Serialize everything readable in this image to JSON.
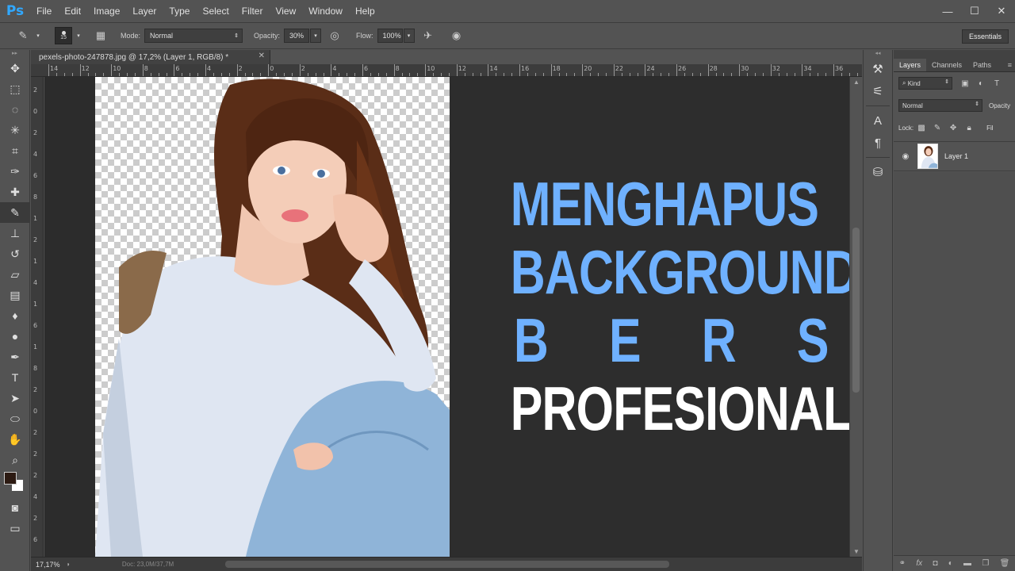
{
  "app": {
    "logo": "Ps"
  },
  "menu": [
    "File",
    "Edit",
    "Image",
    "Layer",
    "Type",
    "Select",
    "Filter",
    "View",
    "Window",
    "Help"
  ],
  "window_controls": [
    "—",
    "☐",
    "✕"
  ],
  "options": {
    "brush_size": "15",
    "mode_label": "Mode:",
    "mode_value": "Normal",
    "opacity_label": "Opacity:",
    "opacity_value": "30%",
    "flow_label": "Flow:",
    "flow_value": "100%",
    "workspace": "Essentials"
  },
  "document": {
    "tab_title": "pexels-photo-247878.jpg @ 17,2% (Layer 1, RGB/8) *",
    "zoom": "17,17%",
    "doc_info": "Doc: 23,0M/37,7M"
  },
  "ruler_top": [
    "14",
    "12",
    "10",
    "8",
    "6",
    "4",
    "2",
    "0",
    "2",
    "4",
    "6",
    "8",
    "10",
    "12",
    "14",
    "16",
    "18",
    "20",
    "22",
    "24",
    "26",
    "28",
    "30",
    "32",
    "34",
    "36"
  ],
  "ruler_left": [
    "2",
    "0",
    "2",
    "4",
    "6",
    "8",
    "1",
    "2",
    "1",
    "4",
    "1",
    "6",
    "1",
    "8",
    "2",
    "0",
    "2",
    "2",
    "2",
    "4",
    "2",
    "6"
  ],
  "headline": {
    "line1": "MENGHAPUS",
    "line2": "BACKGROUND",
    "line3": "B E R S I H",
    "line4": "PROFESIONAL",
    "accent_color": "#6fb1ff"
  },
  "layers_panel": {
    "tabs": [
      "Layers",
      "Channels",
      "Paths"
    ],
    "filter_kind": "Kind",
    "blend_mode": "Normal",
    "opacity_label": "Opacity",
    "lock_label": "Lock:",
    "fill_label": "Fil",
    "layer_name": "Layer 1"
  },
  "icons": {
    "tools": [
      "move-icon",
      "marquee-icon",
      "lasso-icon",
      "magic-wand-icon",
      "crop-icon",
      "eyedropper-icon",
      "healing-icon",
      "brush-icon",
      "stamp-icon",
      "history-brush-icon",
      "eraser-icon",
      "gradient-icon",
      "blur-icon",
      "dodge-icon",
      "pen-icon",
      "type-icon",
      "path-select-icon",
      "ellipse-icon",
      "hand-icon",
      "zoom-icon"
    ]
  }
}
